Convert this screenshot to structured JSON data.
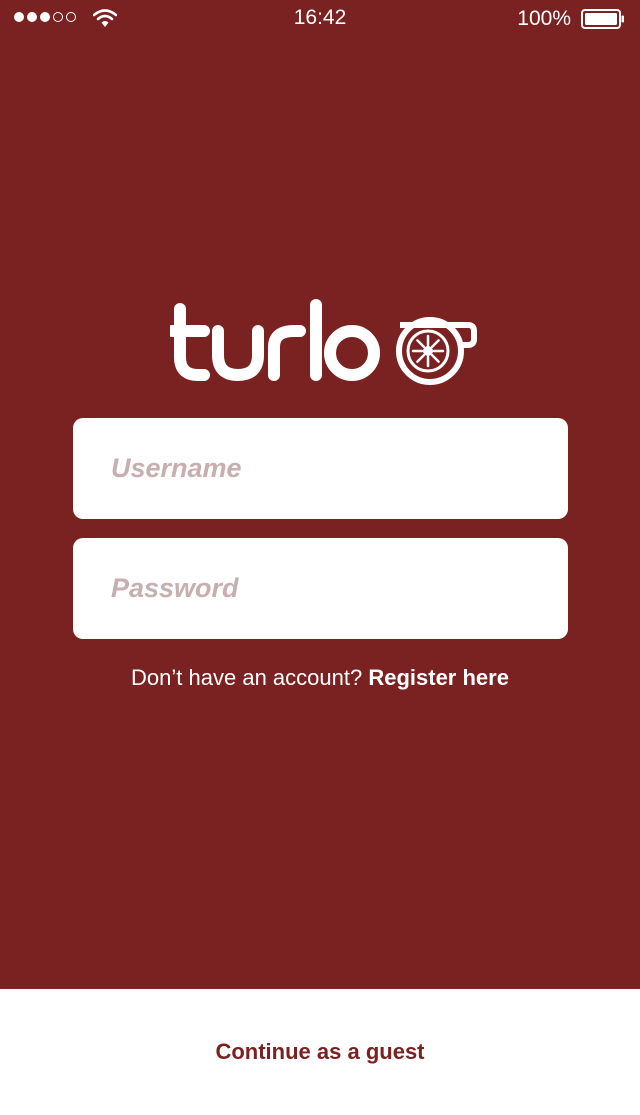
{
  "status_bar": {
    "signal_bars_filled": 3,
    "signal_bars_total": 5,
    "wifi_icon": "wifi-icon",
    "time": "16:42",
    "battery_percent": "100%",
    "battery_icon": "battery-icon",
    "battery_level": 1.0
  },
  "logo": {
    "text": "turbo",
    "icon": "turbocharger-icon"
  },
  "login_form": {
    "username_placeholder": "Username",
    "username_value": "",
    "password_placeholder": "Password",
    "password_value": ""
  },
  "register": {
    "prompt": "Don’t have an account? ",
    "link_label": "Register here"
  },
  "guest": {
    "button_label": "Continue as a guest"
  },
  "colors": {
    "background": "#7a2222",
    "field_background": "#ffffff",
    "placeholder": "#c7aeb0",
    "text_light": "#ffffff",
    "guest_text": "#7a2222"
  }
}
